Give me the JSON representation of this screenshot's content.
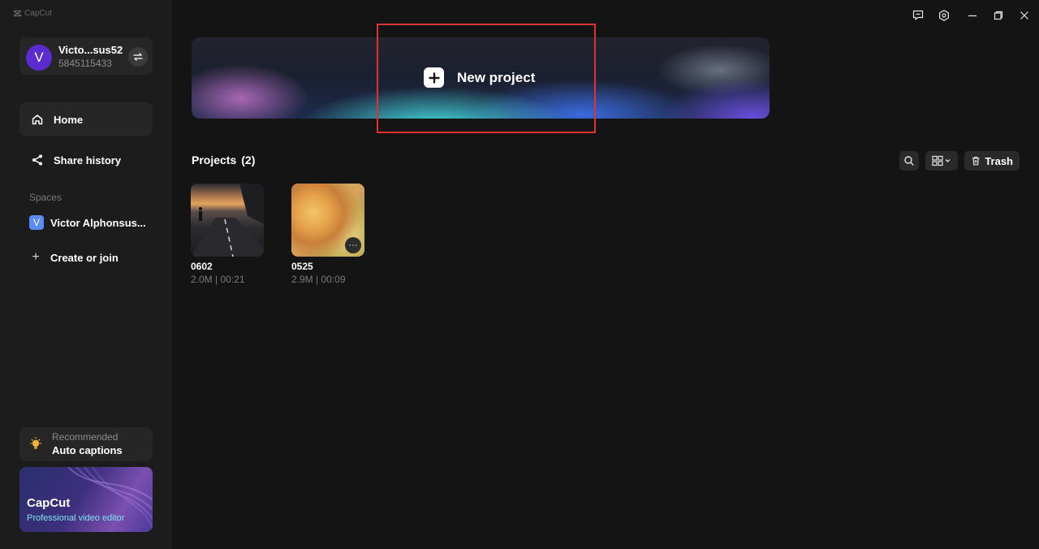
{
  "app": {
    "name": "CapCut"
  },
  "user": {
    "avatar_letter": "V",
    "name": "Victo...sus52",
    "id": "5845115433"
  },
  "nav": {
    "home": "Home",
    "share_history": "Share history"
  },
  "spaces": {
    "label": "Spaces",
    "items": [
      {
        "badge": "V",
        "name": "Victor Alphonsus..."
      }
    ],
    "create_label": "Create or join"
  },
  "recommended": {
    "label": "Recommended",
    "title": "Auto captions"
  },
  "promo": {
    "title": "CapCut",
    "subtitle": "Professional video editor"
  },
  "hero": {
    "label": "New project"
  },
  "projects": {
    "title": "Projects",
    "count": "(2)",
    "trash_label": "Trash",
    "items": [
      {
        "name": "0602",
        "meta": "2.0M | 00:21"
      },
      {
        "name": "0525",
        "meta": "2.9M | 00:09"
      }
    ]
  },
  "colors": {
    "background": "#141414",
    "sidebar": "#1c1c1c",
    "card": "#262626",
    "avatar": "#5a2bd1",
    "space_badge": "#5b8cf5",
    "highlight": "#e03232"
  }
}
